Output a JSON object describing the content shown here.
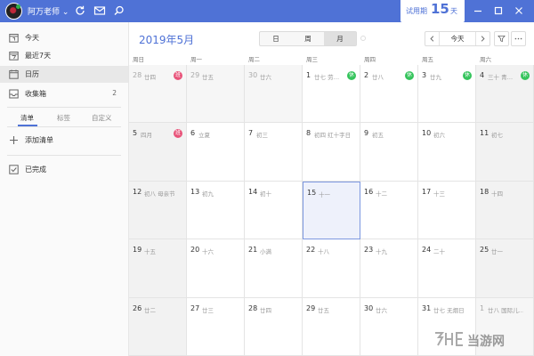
{
  "titlebar": {
    "username": "阿万老师 ⌄",
    "trial_label": "试用期",
    "trial_days": "15",
    "trial_unit": "天",
    "accent": "#4f72d6"
  },
  "sidebar": {
    "items": [
      {
        "label": "今天",
        "icon": "today-icon"
      },
      {
        "label": "最近7天",
        "icon": "week-icon"
      },
      {
        "label": "日历",
        "icon": "calendar-icon",
        "active": true
      },
      {
        "label": "收集箱",
        "icon": "inbox-icon",
        "count": "2"
      }
    ],
    "tabs": [
      "清单",
      "标签",
      "自定义"
    ],
    "add_list": "添加清单",
    "completed": "已完成"
  },
  "toolbar": {
    "title": "2019年5月",
    "views": [
      "日",
      "周",
      "月"
    ],
    "active_view": "月",
    "today": "今天"
  },
  "calendar": {
    "weekdays": [
      "周日",
      "周一",
      "周二",
      "周三",
      "周四",
      "周五",
      "周六"
    ],
    "weeks": [
      [
        {
          "day": "28",
          "lunar": "廿四",
          "badge": "班",
          "outside": true
        },
        {
          "day": "29",
          "lunar": "廿五",
          "outside": true
        },
        {
          "day": "30",
          "lunar": "廿六",
          "outside": true
        },
        {
          "day": "1",
          "lunar": "廿七 劳…",
          "badge": "休"
        },
        {
          "day": "2",
          "lunar": "廿八",
          "badge": "休"
        },
        {
          "day": "3",
          "lunar": "廿九",
          "badge": "休"
        },
        {
          "day": "4",
          "lunar": "三十 青…",
          "badge": "休"
        }
      ],
      [
        {
          "day": "5",
          "lunar": "四月",
          "badge": "班"
        },
        {
          "day": "6",
          "lunar": "立夏"
        },
        {
          "day": "7",
          "lunar": "初三"
        },
        {
          "day": "8",
          "lunar": "初四 红十字日"
        },
        {
          "day": "9",
          "lunar": "初五"
        },
        {
          "day": "10",
          "lunar": "初六"
        },
        {
          "day": "11",
          "lunar": "初七"
        }
      ],
      [
        {
          "day": "12",
          "lunar": "初八 母亲节"
        },
        {
          "day": "13",
          "lunar": "初九"
        },
        {
          "day": "14",
          "lunar": "初十"
        },
        {
          "day": "15",
          "lunar": "十一",
          "today": true
        },
        {
          "day": "16",
          "lunar": "十二"
        },
        {
          "day": "17",
          "lunar": "十三"
        },
        {
          "day": "18",
          "lunar": "十四"
        }
      ],
      [
        {
          "day": "19",
          "lunar": "十五"
        },
        {
          "day": "20",
          "lunar": "十六"
        },
        {
          "day": "21",
          "lunar": "小满"
        },
        {
          "day": "22",
          "lunar": "十八"
        },
        {
          "day": "23",
          "lunar": "十九"
        },
        {
          "day": "24",
          "lunar": "二十"
        },
        {
          "day": "25",
          "lunar": "廿一"
        }
      ],
      [
        {
          "day": "26",
          "lunar": "廿二"
        },
        {
          "day": "27",
          "lunar": "廿三"
        },
        {
          "day": "28",
          "lunar": "廿四"
        },
        {
          "day": "29",
          "lunar": "廿五"
        },
        {
          "day": "30",
          "lunar": "廿六"
        },
        {
          "day": "31",
          "lunar": "廿七 无烟日"
        },
        {
          "day": "1",
          "lunar": "廿八 国际儿…",
          "outside": true
        }
      ]
    ],
    "badge_colors": {
      "休": "#35c45c",
      "班": "#e8547a"
    }
  },
  "watermark": {
    "text": "当游网"
  }
}
